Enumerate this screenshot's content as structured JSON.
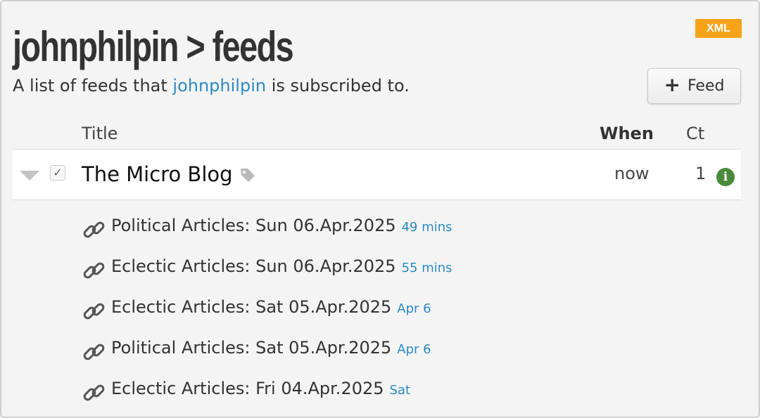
{
  "header": {
    "title": "johnphilpin > feeds",
    "xml_badge": "XML",
    "subtitle_before": "A list of feeds that ",
    "subtitle_user": "johnphilpin",
    "subtitle_after": " is subscribed to.",
    "add_feed_label": "Feed"
  },
  "columns": {
    "title": "Title",
    "when": "When",
    "ct": "Ct"
  },
  "feed": {
    "name": "The Micro Blog",
    "when": "now",
    "ct": "1",
    "checked": true
  },
  "items": [
    {
      "title": "Political Articles: Sun 06.Apr.2025",
      "age": "49 mins"
    },
    {
      "title": "Eclectic Articles: Sun 06.Apr.2025",
      "age": "55 mins"
    },
    {
      "title": "Eclectic Articles: Sat 05.Apr.2025",
      "age": "Apr 6"
    },
    {
      "title": "Political Articles: Sat 05.Apr.2025",
      "age": "Apr 6"
    },
    {
      "title": "Eclectic Articles: Fri 04.Apr.2025",
      "age": "Sat"
    }
  ],
  "colors": {
    "link": "#2a8bc4",
    "xml_badge": "#f7a31a",
    "info": "#4a8a3b"
  },
  "icons": {
    "add": "plus-icon",
    "tag": "tag-icon",
    "info": "info-icon",
    "item": "link-icon",
    "expand": "caret-down-icon",
    "check": "checkbox-icon"
  }
}
